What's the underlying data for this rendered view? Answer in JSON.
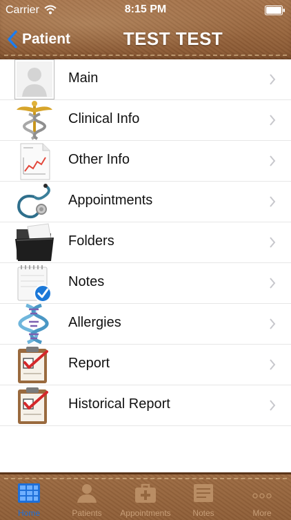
{
  "status_bar": {
    "carrier": "Carrier",
    "time": "8:15 PM"
  },
  "nav": {
    "back_label": "Patient",
    "title": "TEST TEST"
  },
  "menu": {
    "items": [
      {
        "label": "Main",
        "icon": "person-placeholder-icon"
      },
      {
        "label": "Clinical Info",
        "icon": "caduceus-icon"
      },
      {
        "label": "Other Info",
        "icon": "chart-document-icon"
      },
      {
        "label": "Appointments",
        "icon": "stethoscope-icon"
      },
      {
        "label": "Folders",
        "icon": "folder-icon"
      },
      {
        "label": "Notes",
        "icon": "notepad-check-icon"
      },
      {
        "label": "Allergies",
        "icon": "dna-icon"
      },
      {
        "label": "Report",
        "icon": "clipboard-check-icon"
      },
      {
        "label": "Historical Report",
        "icon": "clipboard-check-icon"
      }
    ]
  },
  "tab_bar": {
    "tabs": [
      {
        "label": "Home",
        "selected": true
      },
      {
        "label": "Patients",
        "selected": false
      },
      {
        "label": "Appointments",
        "selected": false
      },
      {
        "label": "Notes",
        "selected": false
      },
      {
        "label": "More",
        "selected": false
      }
    ]
  },
  "colors": {
    "accent": "#1e6fd8",
    "leather": "#98653d",
    "tab_inactive": "#c89f79"
  }
}
